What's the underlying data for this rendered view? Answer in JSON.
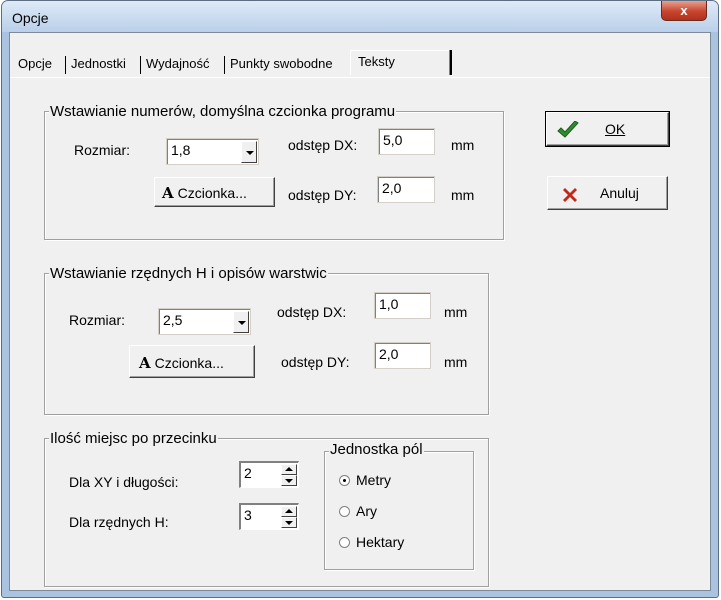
{
  "window": {
    "title": "Opcje",
    "close_label": "x"
  },
  "tabs": [
    {
      "label": "Opcje",
      "active": false
    },
    {
      "label": "Jednostki",
      "active": false
    },
    {
      "label": "Wydajność",
      "active": false
    },
    {
      "label": "Punkty swobodne",
      "active": false
    },
    {
      "label": "Teksty",
      "active": true
    }
  ],
  "group_numbers": {
    "legend": "Wstawianie numerów, domyślna czcionka programu",
    "size_label": "Rozmiar:",
    "size_value": "1,8",
    "dx_label": "odstęp DX:",
    "dx_value": "5,0",
    "dx_unit": "mm",
    "dy_label": "odstęp DY:",
    "dy_value": "2,0",
    "dy_unit": "mm",
    "font_button": "Czcionka...",
    "font_button_icon": "A"
  },
  "group_elevations": {
    "legend": "Wstawianie rzędnych H i opisów warstwic",
    "size_label": "Rozmiar:",
    "size_value": "2,5",
    "dx_label": "odstęp DX:",
    "dx_value": "1,0",
    "dx_unit": "mm",
    "dy_label": "odstęp DY:",
    "dy_value": "2,0",
    "dy_unit": "mm",
    "font_button": "Czcionka...",
    "font_button_icon": "A"
  },
  "group_decimals": {
    "legend": "Ilość miejsc po przecinku",
    "xy_label": "Dla XY i długości:",
    "xy_value": "2",
    "h_label": "Dla rzędnych H:",
    "h_value": "3"
  },
  "group_area_unit": {
    "legend": "Jednostka pól",
    "options": [
      {
        "label": "Metry",
        "selected": true
      },
      {
        "label": "Ary",
        "selected": false
      },
      {
        "label": "Hektary",
        "selected": false
      }
    ]
  },
  "buttons": {
    "ok_label": "OK",
    "ok_icon_color": "#2e8b2e",
    "cancel_label": "Anuluj",
    "cancel_icon_color": "#c0281a"
  }
}
